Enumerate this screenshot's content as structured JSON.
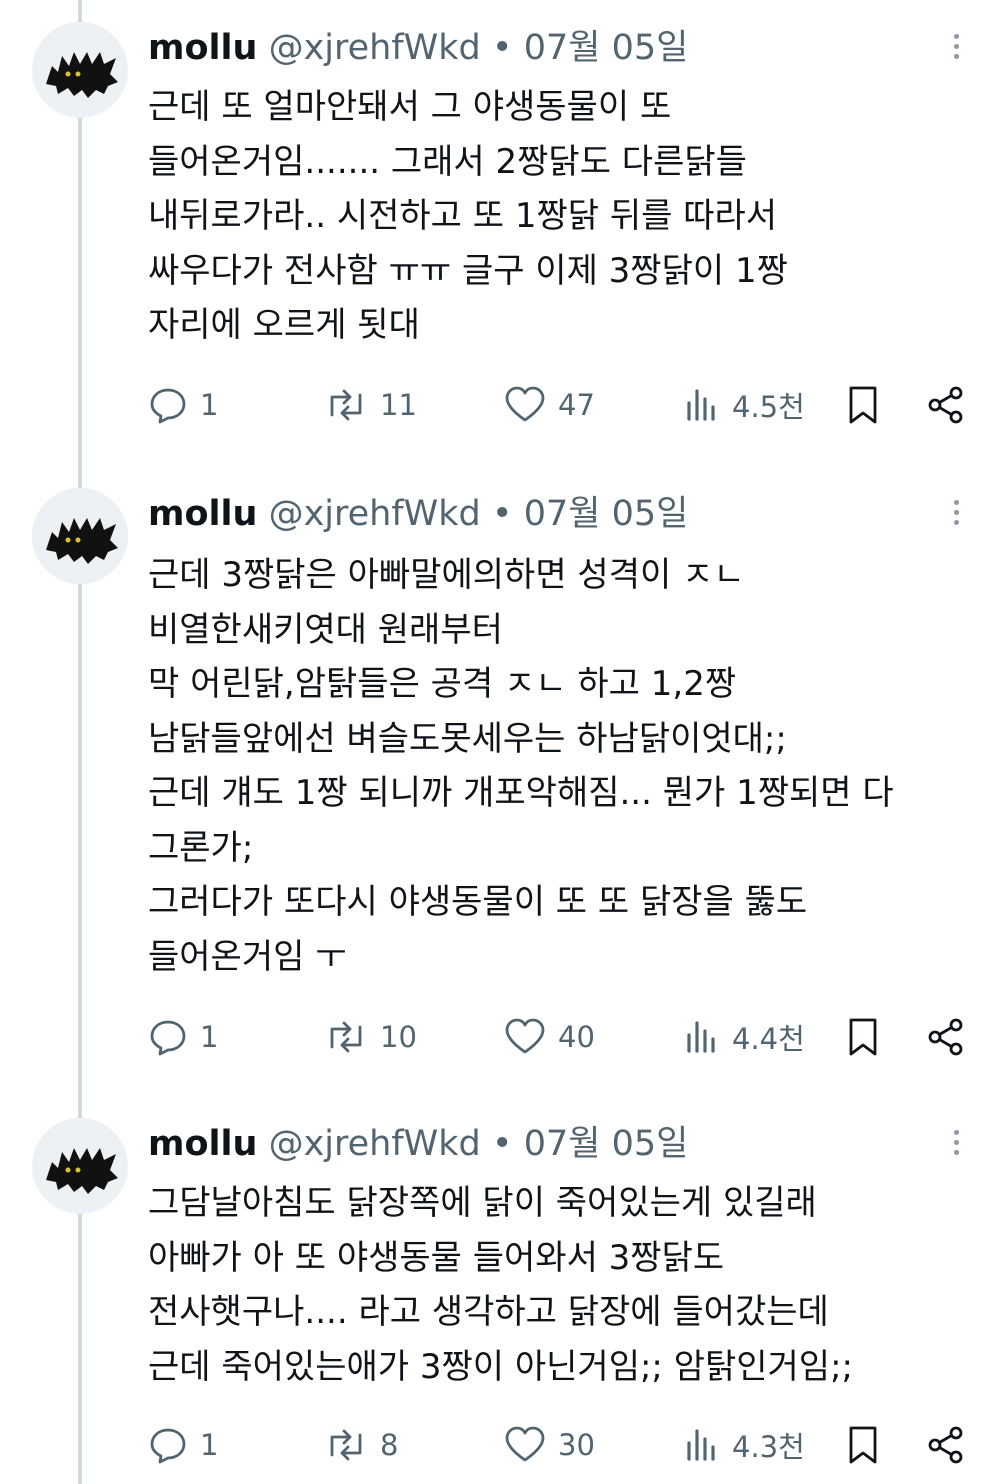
{
  "thread": {
    "tweets": [
      {
        "author_name": "mollu",
        "handle": "@xjrehfWkd",
        "separator": "•",
        "date": "07월 05일",
        "text_lines": [
          "근데 또 얼마안돼서 그 야생동물이 또",
          "들어온거임....... 그래서 2짱닭도 다른닭들",
          "내뒤로가라.. 시전하고 또 1짱닭 뒤를 따라서",
          "싸우다가 전사함 ㅠㅠ 글구 이제 3짱닭이 1짱",
          "자리에 오르게 됫대"
        ],
        "replies": "1",
        "reposts": "11",
        "likes": "47",
        "views": "4.5천"
      },
      {
        "author_name": "mollu",
        "handle": "@xjrehfWkd",
        "separator": "•",
        "date": "07월 05일",
        "text_lines": [
          "근데 3짱닭은 아빠말에의하면 성격이 ㅈㄴ",
          "비열한새키엿대 원래부터",
          "막 어린닭,암탉들은 공격 ㅈㄴ 하고 1,2짱",
          "남닭들앞에선 벼슬도못세우는 하남닭이엇대;;",
          "근데 걔도 1짱 되니까 개포악해짐... 뭔가 1짱되면 다",
          "그론가;",
          "그러다가 또다시 야생동물이 또 또 닭장을 뚫도",
          "들어온거임 ㅜ"
        ],
        "replies": "1",
        "reposts": "10",
        "likes": "40",
        "views": "4.4천"
      },
      {
        "author_name": "mollu",
        "handle": "@xjrehfWkd",
        "separator": "•",
        "date": "07월 05일",
        "text_lines": [
          "그담날아침도 닭장쪽에 닭이 죽어있는게 있길래",
          "아빠가 아 또 야생동물 들어와서 3짱닭도",
          "전사햇구나.... 라고 생각하고 닭장에 들어갔는데",
          "근데 죽어있는애가 3짱이 아닌거임;; 암탉인거임;;"
        ],
        "replies": "1",
        "reposts": "8",
        "likes": "30",
        "views": "4.3천"
      }
    ]
  },
  "icons": {
    "avatar": "black-cat-avatar",
    "reply": "speech-bubble-icon",
    "repost": "repost-arrows-icon",
    "like": "heart-icon",
    "views": "bar-chart-icon",
    "bookmark": "bookmark-icon",
    "share": "share-icon",
    "more": "vertical-ellipsis-icon"
  },
  "colors": {
    "text": "#0f1419",
    "secondary": "#536471",
    "thread_line": "#cfd9de"
  }
}
